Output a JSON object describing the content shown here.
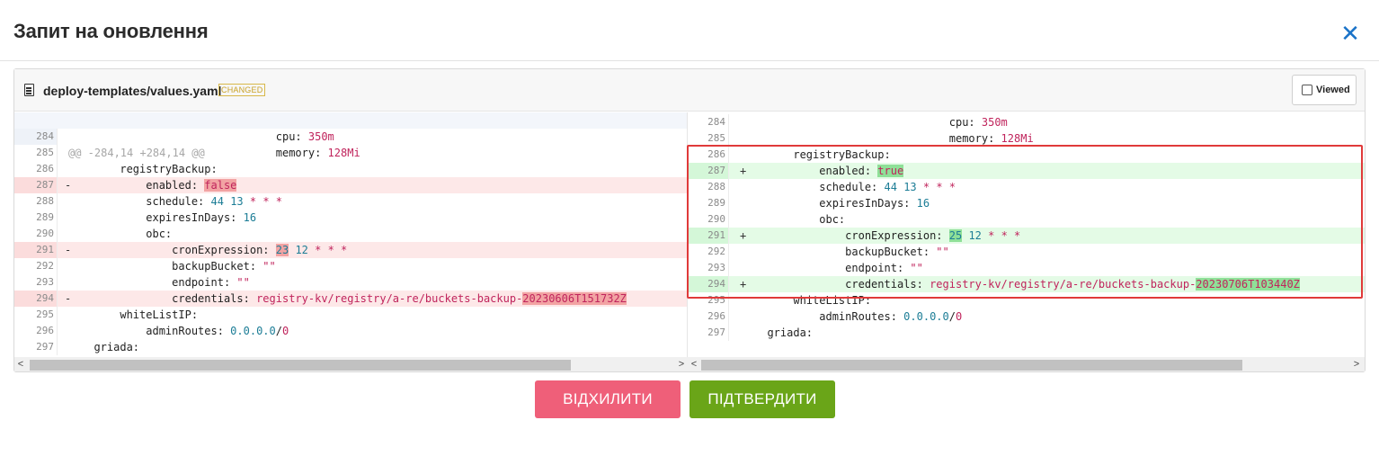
{
  "dialog": {
    "title": "Запит на оновлення",
    "close_icon": "close-icon"
  },
  "file": {
    "name": "deploy-templates/values.yaml",
    "badge": "CHANGED",
    "viewed_label": "Viewed",
    "viewed_checked": false
  },
  "diff": {
    "hunk": "@@ -284,14 +284,14 @@",
    "left": [
      {
        "ln": "284",
        "mk": "",
        "type": "ctx",
        "parts": [
          {
            "t": "                              cpu: "
          },
          {
            "t": "350m",
            "c": "s"
          }
        ]
      },
      {
        "ln": "285",
        "mk": "",
        "type": "ctx",
        "parts": [
          {
            "t": "                              memory: "
          },
          {
            "t": "128Mi",
            "c": "s"
          }
        ]
      },
      {
        "ln": "286",
        "mk": "",
        "type": "ctx",
        "parts": [
          {
            "t": "      registryBackup:"
          }
        ]
      },
      {
        "ln": "287",
        "mk": "-",
        "type": "del",
        "parts": [
          {
            "t": "          enabled: "
          },
          {
            "t": "false",
            "c": "s hl-del"
          }
        ]
      },
      {
        "ln": "288",
        "mk": "",
        "type": "ctx",
        "parts": [
          {
            "t": "          schedule: "
          },
          {
            "t": "44",
            "c": "n"
          },
          {
            "t": " "
          },
          {
            "t": "13",
            "c": "n"
          },
          {
            "t": " "
          },
          {
            "t": "* * *",
            "c": "s"
          }
        ]
      },
      {
        "ln": "289",
        "mk": "",
        "type": "ctx",
        "parts": [
          {
            "t": "          expiresInDays: "
          },
          {
            "t": "16",
            "c": "n"
          }
        ]
      },
      {
        "ln": "290",
        "mk": "",
        "type": "ctx",
        "parts": [
          {
            "t": "          obc:"
          }
        ]
      },
      {
        "ln": "291",
        "mk": "-",
        "type": "del",
        "parts": [
          {
            "t": "              cronExpression: "
          },
          {
            "t": "23",
            "c": "n hl-del"
          },
          {
            "t": " "
          },
          {
            "t": "12",
            "c": "n"
          },
          {
            "t": " "
          },
          {
            "t": "* * *",
            "c": "s"
          }
        ]
      },
      {
        "ln": "292",
        "mk": "",
        "type": "ctx",
        "parts": [
          {
            "t": "              backupBucket: "
          },
          {
            "t": "\"\"",
            "c": "s"
          }
        ]
      },
      {
        "ln": "293",
        "mk": "",
        "type": "ctx",
        "parts": [
          {
            "t": "              endpoint: "
          },
          {
            "t": "\"\"",
            "c": "s"
          }
        ]
      },
      {
        "ln": "294",
        "mk": "-",
        "type": "del",
        "parts": [
          {
            "t": "              credentials: "
          },
          {
            "t": "registry-kv/registry/a-re/buckets-backup-",
            "c": "s"
          },
          {
            "t": "20230606T151732Z",
            "c": "s hl-del"
          }
        ]
      },
      {
        "ln": "295",
        "mk": "",
        "type": "ctx",
        "parts": [
          {
            "t": "      whiteListIP:"
          }
        ]
      },
      {
        "ln": "296",
        "mk": "",
        "type": "ctx",
        "parts": [
          {
            "t": "          adminRoutes: "
          },
          {
            "t": "0.0.0.0",
            "c": "n"
          },
          {
            "t": "/"
          },
          {
            "t": "0",
            "c": "s"
          }
        ]
      },
      {
        "ln": "297",
        "mk": "",
        "type": "ctx",
        "parts": [
          {
            "t": "  griada:"
          }
        ]
      }
    ],
    "right": [
      {
        "ln": "284",
        "mk": "",
        "type": "ctx",
        "parts": [
          {
            "t": "                              cpu: "
          },
          {
            "t": "350m",
            "c": "s"
          }
        ]
      },
      {
        "ln": "285",
        "mk": "",
        "type": "ctx",
        "parts": [
          {
            "t": "                              memory: "
          },
          {
            "t": "128Mi",
            "c": "s"
          }
        ]
      },
      {
        "ln": "286",
        "mk": "",
        "type": "ctx",
        "parts": [
          {
            "t": "      registryBackup:"
          }
        ]
      },
      {
        "ln": "287",
        "mk": "+",
        "type": "add",
        "parts": [
          {
            "t": "          enabled: "
          },
          {
            "t": "true",
            "c": "s hl-add"
          }
        ]
      },
      {
        "ln": "288",
        "mk": "",
        "type": "ctx",
        "parts": [
          {
            "t": "          schedule: "
          },
          {
            "t": "44",
            "c": "n"
          },
          {
            "t": " "
          },
          {
            "t": "13",
            "c": "n"
          },
          {
            "t": " "
          },
          {
            "t": "* * *",
            "c": "s"
          }
        ]
      },
      {
        "ln": "289",
        "mk": "",
        "type": "ctx",
        "parts": [
          {
            "t": "          expiresInDays: "
          },
          {
            "t": "16",
            "c": "n"
          }
        ]
      },
      {
        "ln": "290",
        "mk": "",
        "type": "ctx",
        "parts": [
          {
            "t": "          obc:"
          }
        ]
      },
      {
        "ln": "291",
        "mk": "+",
        "type": "add",
        "parts": [
          {
            "t": "              cronExpression: "
          },
          {
            "t": "25",
            "c": "n hl-add"
          },
          {
            "t": " "
          },
          {
            "t": "12",
            "c": "n"
          },
          {
            "t": " "
          },
          {
            "t": "* * *",
            "c": "s"
          }
        ]
      },
      {
        "ln": "292",
        "mk": "",
        "type": "ctx",
        "parts": [
          {
            "t": "              backupBucket: "
          },
          {
            "t": "\"\"",
            "c": "s"
          }
        ]
      },
      {
        "ln": "293",
        "mk": "",
        "type": "ctx",
        "parts": [
          {
            "t": "              endpoint: "
          },
          {
            "t": "\"\"",
            "c": "s"
          }
        ]
      },
      {
        "ln": "294",
        "mk": "+",
        "type": "add",
        "parts": [
          {
            "t": "              credentials: "
          },
          {
            "t": "registry-kv/registry/a-re/buckets-backup-",
            "c": "s"
          },
          {
            "t": "20230706T103440Z",
            "c": "s hl-add"
          }
        ]
      },
      {
        "ln": "295",
        "mk": "",
        "type": "ctx",
        "parts": [
          {
            "t": "      whiteListIP:"
          }
        ]
      },
      {
        "ln": "296",
        "mk": "",
        "type": "ctx",
        "parts": [
          {
            "t": "          adminRoutes: "
          },
          {
            "t": "0.0.0.0",
            "c": "n"
          },
          {
            "t": "/"
          },
          {
            "t": "0",
            "c": "s"
          }
        ]
      },
      {
        "ln": "297",
        "mk": "",
        "type": "ctx",
        "parts": [
          {
            "t": "  griada:"
          }
        ]
      }
    ]
  },
  "actions": {
    "reject_label": "ВІДХИЛИТИ",
    "confirm_label": "ПІДТВЕРДИТИ"
  },
  "colors": {
    "reject": "#ef5f79",
    "confirm": "#6aa518",
    "highlight_box": "#e03a3a",
    "close_icon": "#1a73c8"
  }
}
